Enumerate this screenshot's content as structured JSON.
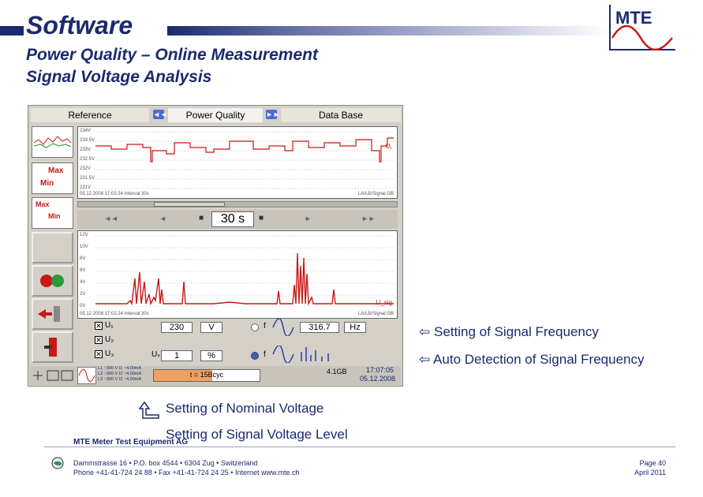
{
  "slide": {
    "title": "Software",
    "subtitle_line1": "Power Quality – Online Measurement",
    "subtitle_line2": "Signal Voltage Analysis",
    "logo_text": "MTE"
  },
  "app": {
    "tabs": [
      "Reference",
      "Power Quality",
      "Data Base"
    ],
    "prev_symbol": "◄◄",
    "next_symbol": "►►",
    "top_chart": {
      "y_ticks": [
        "234V",
        "233.5V",
        "233V",
        "232.5V",
        "232V",
        "231.5V",
        "231V"
      ],
      "series_label": "U₁",
      "footer_left": "05.12.2008 17:02:24  Interval 30s",
      "footer_right": "LA/LB/Signal GB"
    },
    "thumb_labels": {
      "max": "Max",
      "min": "Min",
      "max2": "Max",
      "min2": "Min"
    },
    "transport": {
      "time_window": "30 s",
      "buttons": [
        "◄◄",
        "◄",
        "■",
        "►",
        "►►"
      ]
    },
    "bottom_chart": {
      "y_ticks": [
        "12V",
        "10V",
        "8V",
        "6V",
        "4V",
        "2V",
        "0V"
      ],
      "series_label": "U_sig",
      "footer_left": "05.12.2008 17:02:24  Interval 30s",
      "footer_right": "LA/LB/Signal GB"
    },
    "controls": {
      "phases": [
        "U₁",
        "U₂",
        "U₃"
      ],
      "nominal_voltage_value": "230",
      "nominal_voltage_unit": "V",
      "signal_level_value": "1",
      "signal_level_unit": "%",
      "us_label": "Uₛ",
      "frequency_value": "316.7",
      "frequency_unit": "Hz",
      "f_label": "f"
    },
    "status": {
      "readout_line1": "L1 ~300 V  I1 ~4.00mA",
      "readout_line2": "L2 ~300 V  I2 ~4.00mA",
      "readout_line3": "L3 ~300 V  I3 ~4.00mA",
      "progress_label": "t = 15Bcyc",
      "progress_fraction": 0.55,
      "storage": "4.1GB",
      "time": "17:07:05",
      "date": "05.12.2008"
    }
  },
  "annotations": {
    "freq_setting": "Setting of Signal Frequency",
    "auto_detect": "Auto Detection of Signal Frequency",
    "nominal_voltage": "Setting of Nominal Voltage",
    "signal_level": "Setting of Signal Voltage Level",
    "arrow": "⇦"
  },
  "footer": {
    "company": "MTE Meter Test Equipment AG",
    "address": "Dammstrasse 16 • P.O. box 4544 • 6304 Zug • Switzerland",
    "phone": "Phone +41-41-724 24 88 • Fax +41-41-724 24 25 • Internet www.mte.ch",
    "page": "Page 40",
    "date": "April 2011"
  },
  "colors": {
    "brand": "#1b2a6e",
    "series": "#c81818",
    "progress": "#f0a060"
  }
}
